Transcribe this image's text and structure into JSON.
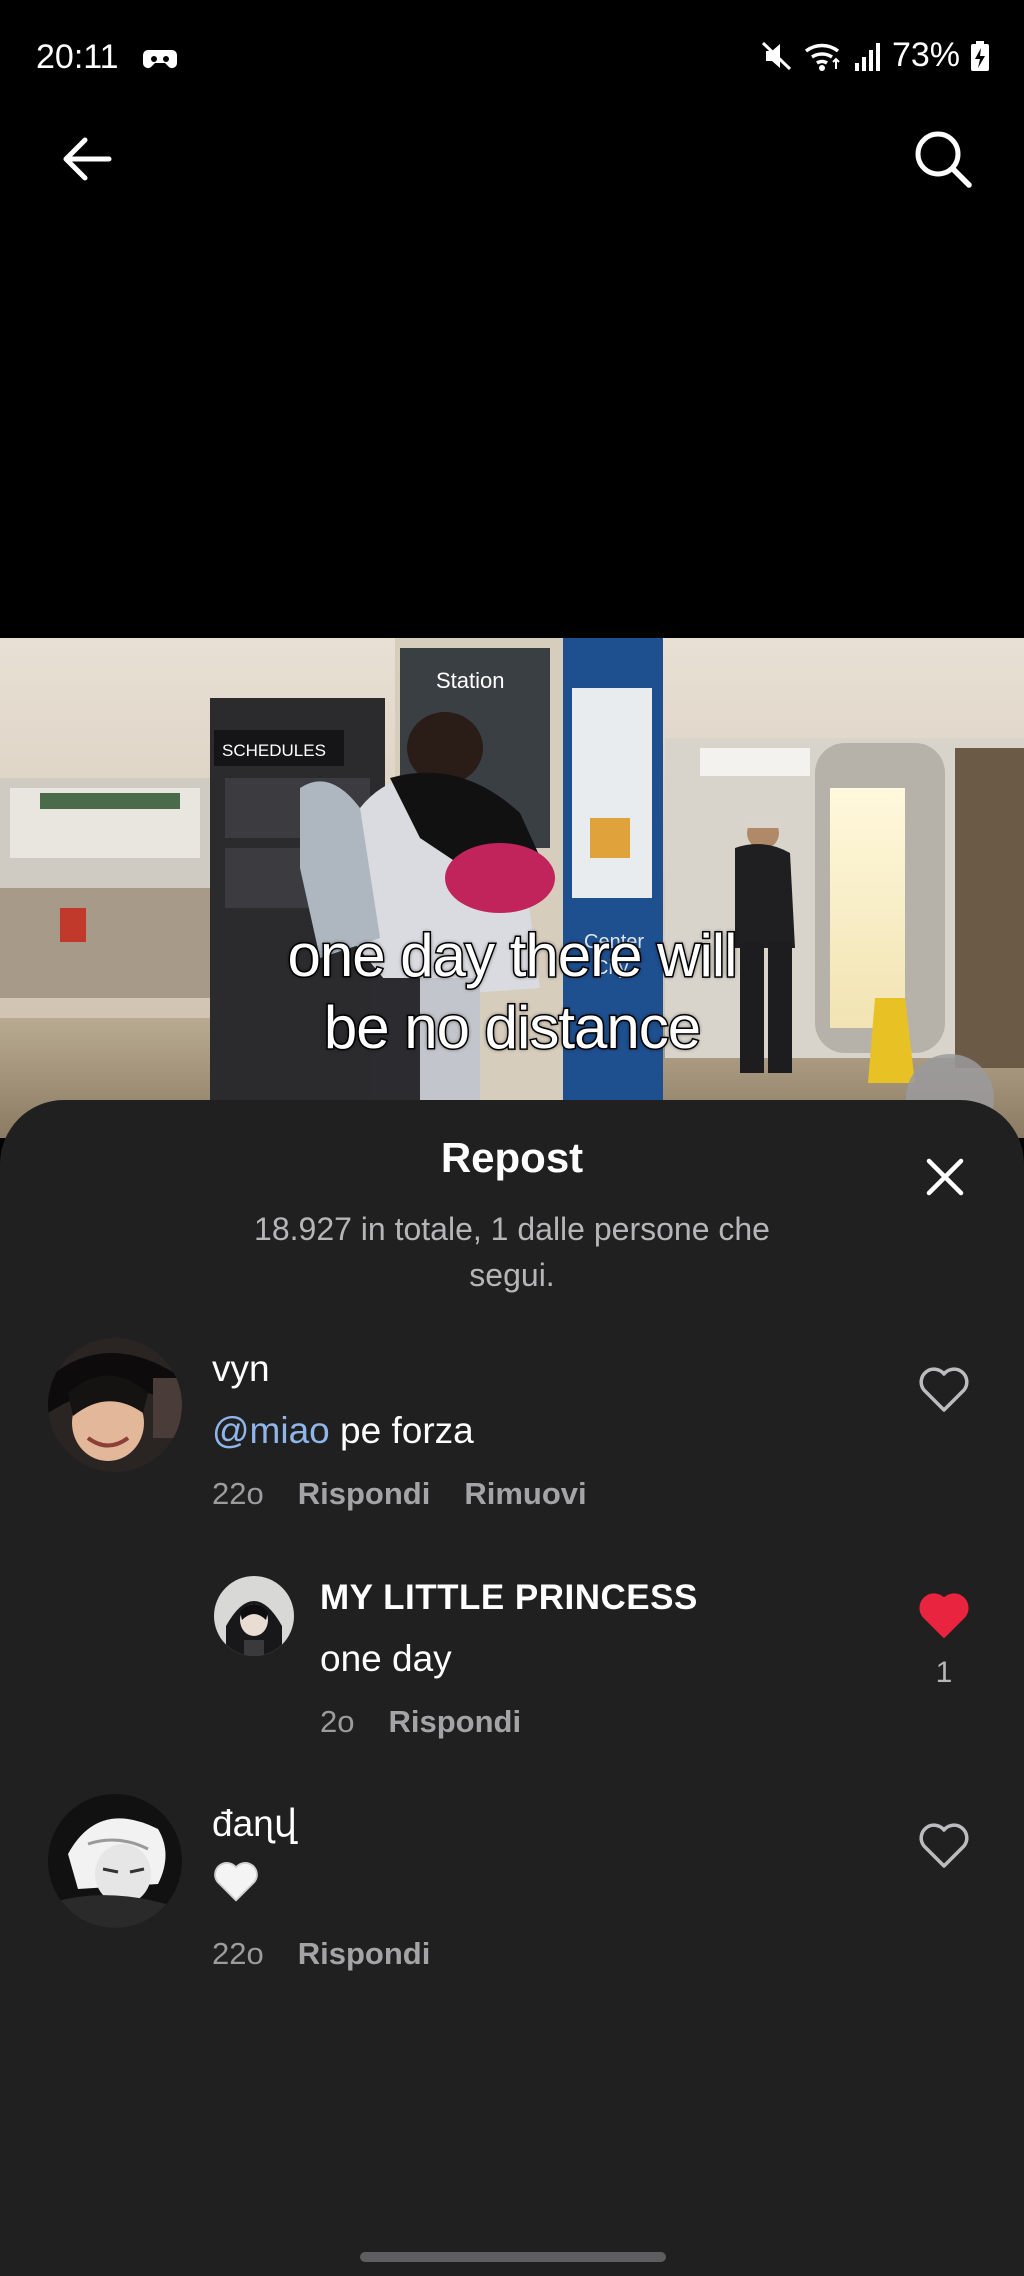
{
  "status_bar": {
    "time": "20:11",
    "battery": "73%"
  },
  "nav": {
    "back_icon": "arrow-left-icon",
    "search_icon": "search-icon"
  },
  "video": {
    "caption_line1": "one day there will",
    "caption_line2": "be no distance",
    "sign_schedules": "SCHEDULES",
    "sign_station": "Station",
    "sign_center": "Center",
    "sign_city": "City"
  },
  "sheet": {
    "title": "Repost",
    "subtitle": "18.927 in totale, 1 dalle persone che segui.",
    "close_icon": "close-icon"
  },
  "comments": [
    {
      "user": "vyn",
      "mention": "@miao",
      "text": " pe forza",
      "time": "22o",
      "reply_label": "Rispondi",
      "remove_label": "Rimuovi",
      "liked": false
    },
    {
      "user": "MY LITTLE PRINCESS",
      "text": "one day",
      "time": "2o",
      "reply_label": "Rispondi",
      "liked": true,
      "like_count": "1"
    },
    {
      "user": "đaɳվ",
      "text": "🤍",
      "time": "22o",
      "reply_label": "Rispondi",
      "liked": false
    }
  ],
  "colors": {
    "sheet_bg": "#202021",
    "liked_heart": "#e8243e",
    "mention": "#8fb5ea"
  }
}
